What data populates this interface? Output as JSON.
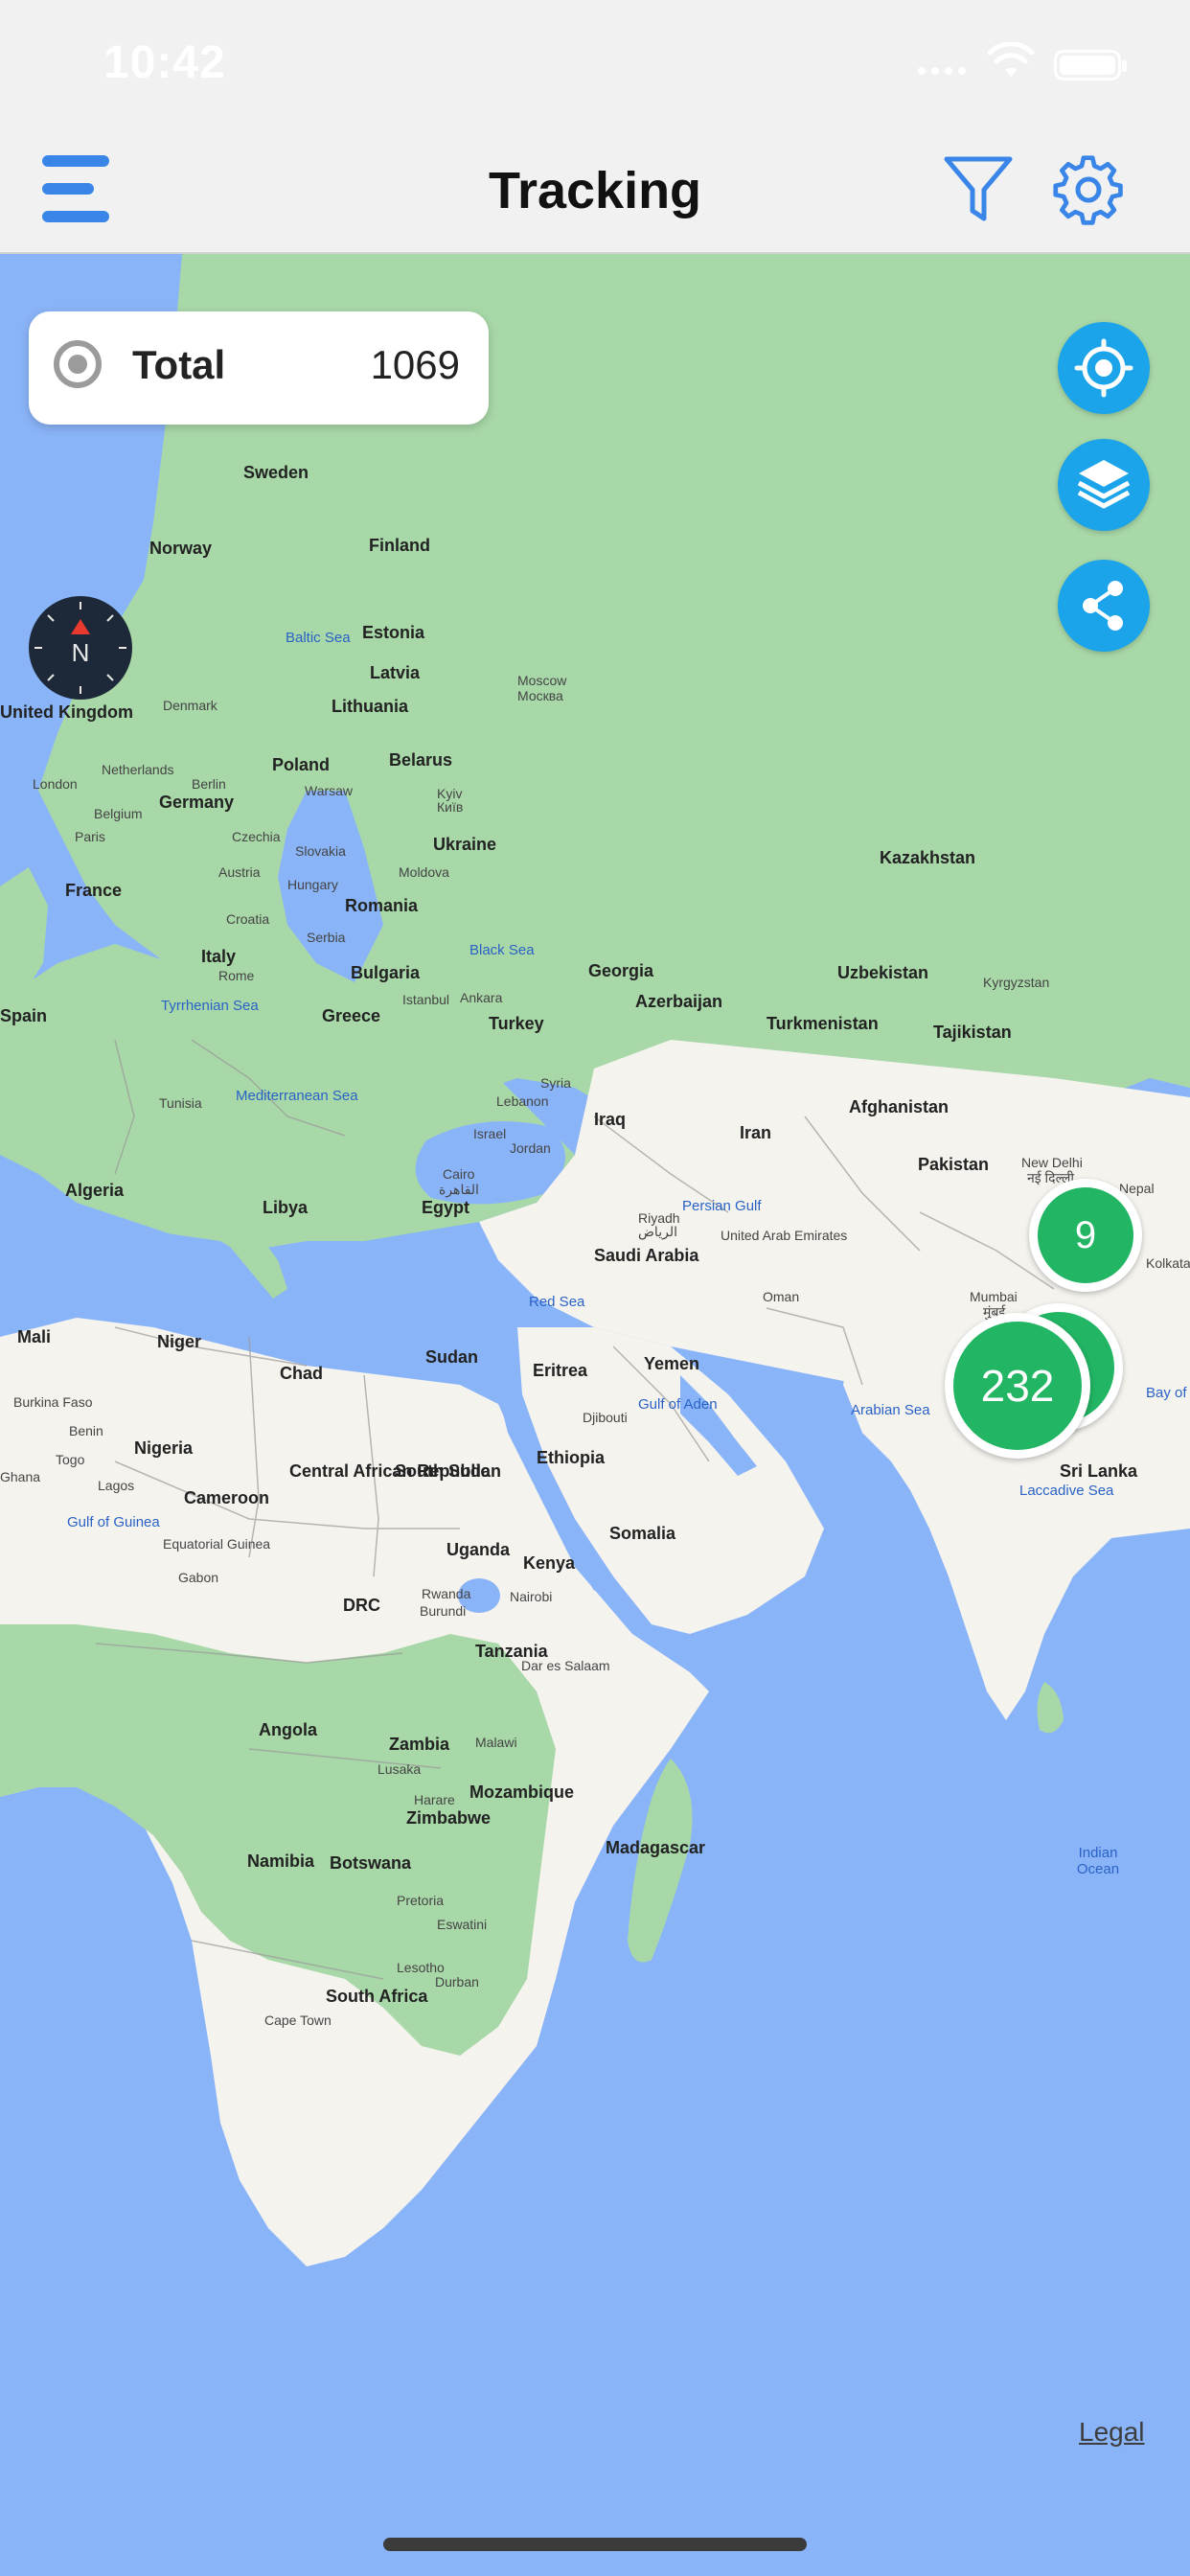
{
  "status_bar": {
    "time": "10:42"
  },
  "header": {
    "title": "Tracking"
  },
  "total_card": {
    "label": "Total",
    "value": "1069"
  },
  "compass": {
    "label": "N"
  },
  "clusters": [
    {
      "count": "9"
    },
    {
      "count": "232"
    }
  ],
  "map_labels": {
    "countries": [
      "Sweden",
      "Norway",
      "Finland",
      "Estonia",
      "Latvia",
      "Lithuania",
      "United Kingdom",
      "Denmark",
      "Netherlands",
      "Belgium",
      "Germany",
      "Poland",
      "Belarus",
      "Ukraine",
      "France",
      "Czechia",
      "Slovakia",
      "Austria",
      "Hungary",
      "Moldova",
      "Romania",
      "Croatia",
      "Serbia",
      "Italy",
      "Bulgaria",
      "Greece",
      "Turkey",
      "Georgia",
      "Azerbaijan",
      "Spain",
      "Tunisia",
      "Syria",
      "Lebanon",
      "Israel",
      "Jordan",
      "Iraq",
      "Iran",
      "Kazakhstan",
      "Uzbekistan",
      "Kyrgyzstan",
      "Turkmenistan",
      "Tajikistan",
      "Afghanistan",
      "Pakistan",
      "Nepal",
      "Algeria",
      "Libya",
      "Egypt",
      "Saudi Arabia",
      "United Arab Emirates",
      "Oman",
      "Yemen",
      "Mali",
      "Niger",
      "Chad",
      "Sudan",
      "Eritrea",
      "Djibouti",
      "Burkina Faso",
      "Benin",
      "Togo",
      "Ghana",
      "Nigeria",
      "Cameroon",
      "Central African Republic",
      "South Sudan",
      "Ethiopia",
      "Somalia",
      "Equatorial Guinea",
      "Gabon",
      "DRC",
      "Uganda",
      "Kenya",
      "Rwanda",
      "Burundi",
      "Tanzania",
      "Angola",
      "Zambia",
      "Malawi",
      "Mozambique",
      "Zimbabwe",
      "Namibia",
      "Botswana",
      "Madagascar",
      "South Africa",
      "Eswatini",
      "Lesotho",
      "Sri Lanka"
    ],
    "cities": [
      "Moscow",
      "Москва",
      "London",
      "Berlin",
      "Warsaw",
      "Kyiv",
      "Київ",
      "Paris",
      "Rome",
      "Istanbul",
      "Ankara",
      "Cairo",
      "القاهرة",
      "Riyadh",
      "الرياض",
      "New Delhi",
      "नई दिल्ली",
      "Mumbai",
      "मुंबई",
      "Kolkata",
      "Lagos",
      "Nairobi",
      "Dar es Salaam",
      "Lusaka",
      "Harare",
      "Pretoria",
      "Durban",
      "Cape Town"
    ],
    "seas": [
      "Baltic Sea",
      "Black Sea",
      "Tyrrhenian Sea",
      "Mediterranean Sea",
      "Persian Gulf",
      "Red Sea",
      "Gulf of Aden",
      "Arabian Sea",
      "Bay of Bengal",
      "Laccadive Sea",
      "Gulf of Guinea",
      "Indian Ocean"
    ]
  },
  "legal_link": "Legal",
  "colors": {
    "accent": "#3a86e8",
    "control": "#1ba4e9",
    "cluster": "#22b564",
    "water": "#8ab4f8",
    "land": "#f5f3ee",
    "vegetation": "#a8d8a8"
  },
  "icons": {
    "menu": "menu-icon",
    "filter": "filter-icon",
    "settings": "gear-icon",
    "locate": "locate-icon",
    "layers": "layers-icon",
    "share": "share-icon"
  }
}
